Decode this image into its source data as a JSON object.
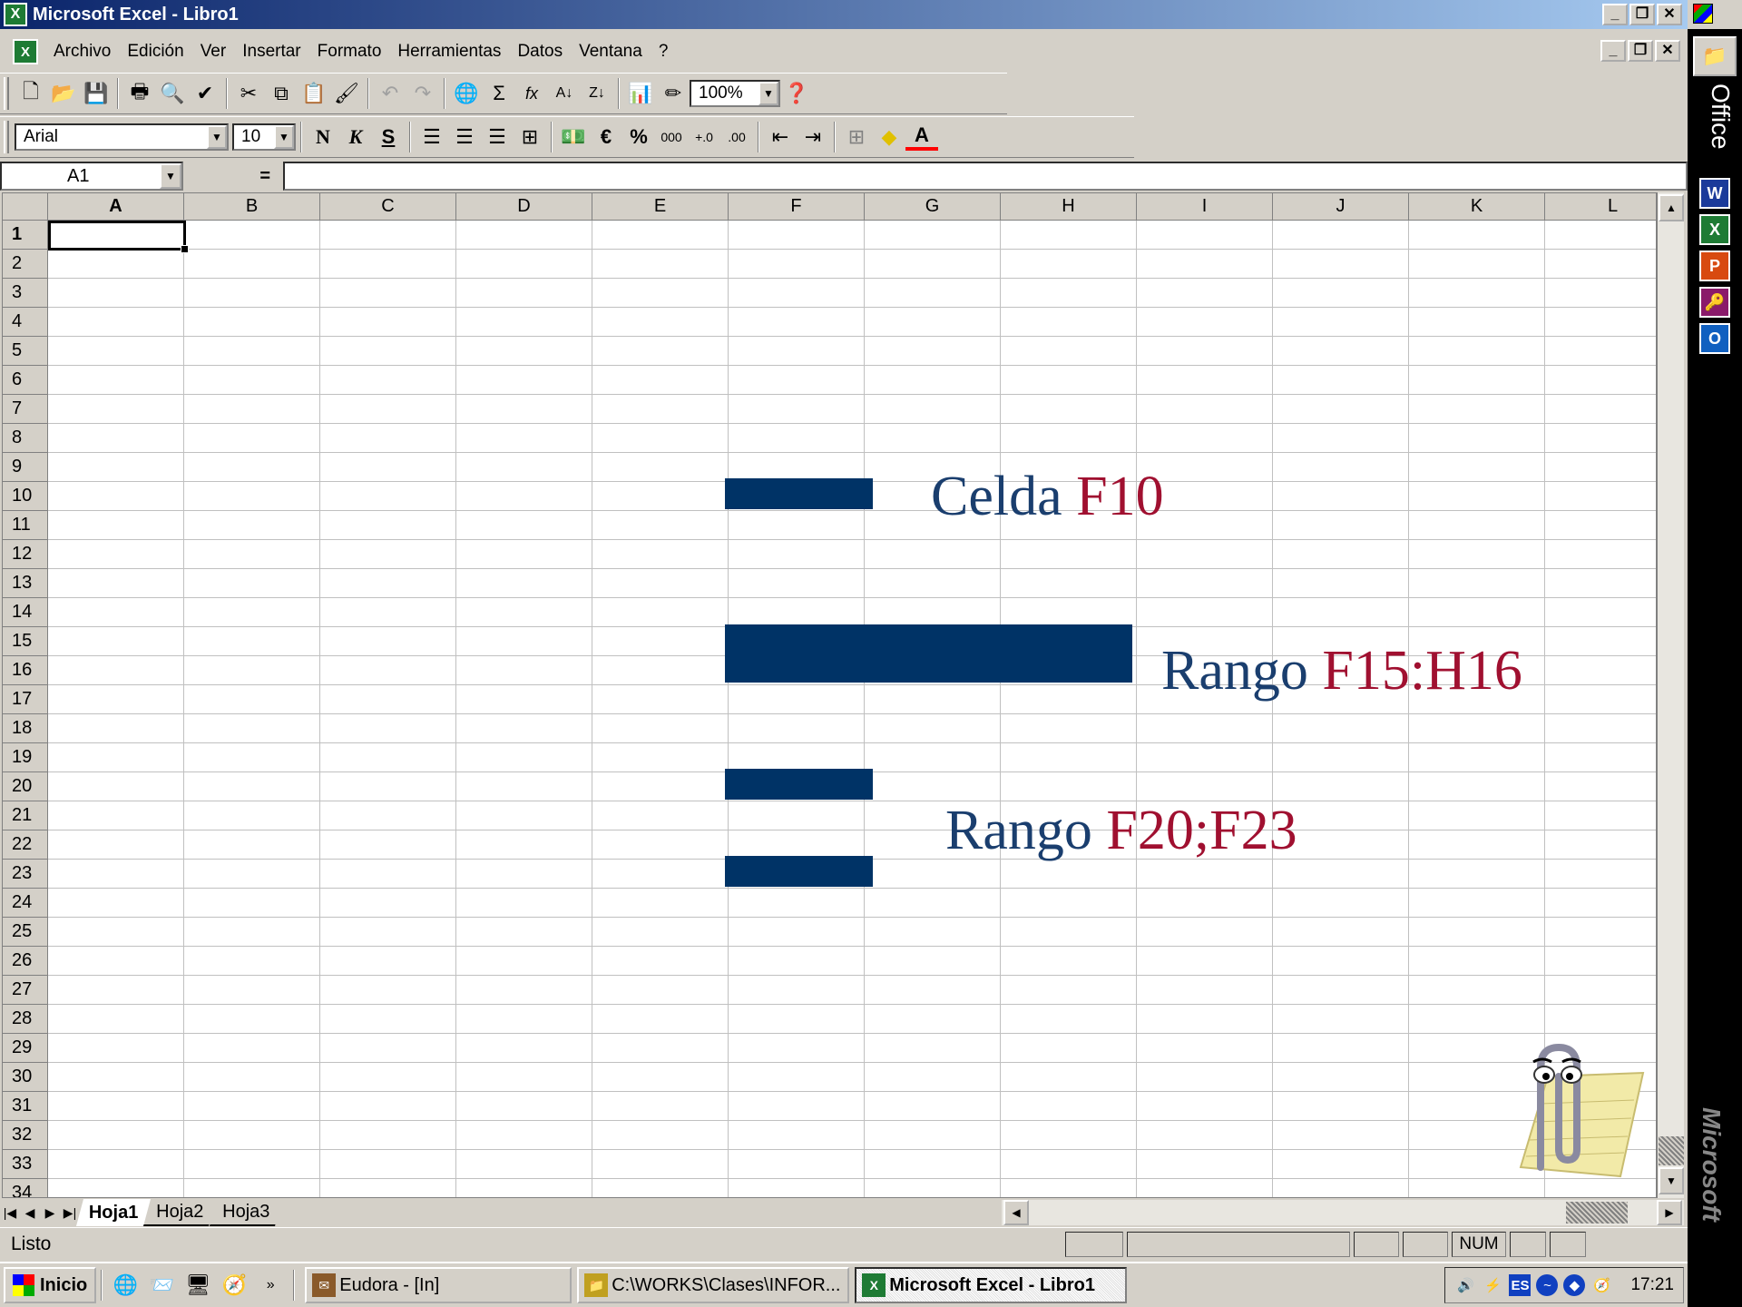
{
  "window": {
    "title": "Microsoft Excel - Libro1"
  },
  "menu": [
    "Archivo",
    "Edición",
    "Ver",
    "Insertar",
    "Formato",
    "Herramientas",
    "Datos",
    "Ventana",
    "?"
  ],
  "standard_toolbar": {
    "zoom": "100%"
  },
  "format_toolbar": {
    "font": "Arial",
    "size": "10",
    "bold": "N",
    "italic": "K",
    "underline": "S",
    "euro": "€",
    "percent": "%",
    "thousands": "000"
  },
  "formula_bar": {
    "name_box": "A1",
    "equals": "="
  },
  "sheet": {
    "columns": [
      "A",
      "B",
      "C",
      "D",
      "E",
      "F",
      "G",
      "H",
      "I",
      "J",
      "K",
      "L"
    ],
    "rows": [
      "1",
      "2",
      "3",
      "4",
      "5",
      "6",
      "7",
      "8",
      "9",
      "10",
      "11",
      "12",
      "13",
      "14",
      "15",
      "16",
      "17",
      "18",
      "19",
      "20",
      "21",
      "22",
      "23",
      "24",
      "25",
      "26",
      "27",
      "28",
      "29",
      "30",
      "31",
      "32",
      "33",
      "34"
    ],
    "active_cell": "A1"
  },
  "annotations": {
    "cell": {
      "word": "Celda",
      "ref": "F10"
    },
    "range1": {
      "word": "Rango",
      "ref": "F15:H16"
    },
    "range2": {
      "word": "Rango",
      "ref": "F20;F23"
    }
  },
  "sheet_tabs": [
    "Hoja1",
    "Hoja2",
    "Hoja3"
  ],
  "status": {
    "text": "Listo",
    "num": "NUM"
  },
  "taskbar": {
    "start": "Inicio",
    "tasks": [
      "Eudora - [In]",
      "C:\\WORKS\\Clases\\INFOR...",
      "Microsoft Excel - Libro1"
    ],
    "tray_lang": "ES",
    "clock": "17:21"
  },
  "office_bar": {
    "label": "Office",
    "brand": "Microsoft"
  },
  "colors": {
    "bar": "#003366",
    "annotation_word": "#1a3e6e",
    "annotation_ref": "#a01030"
  }
}
